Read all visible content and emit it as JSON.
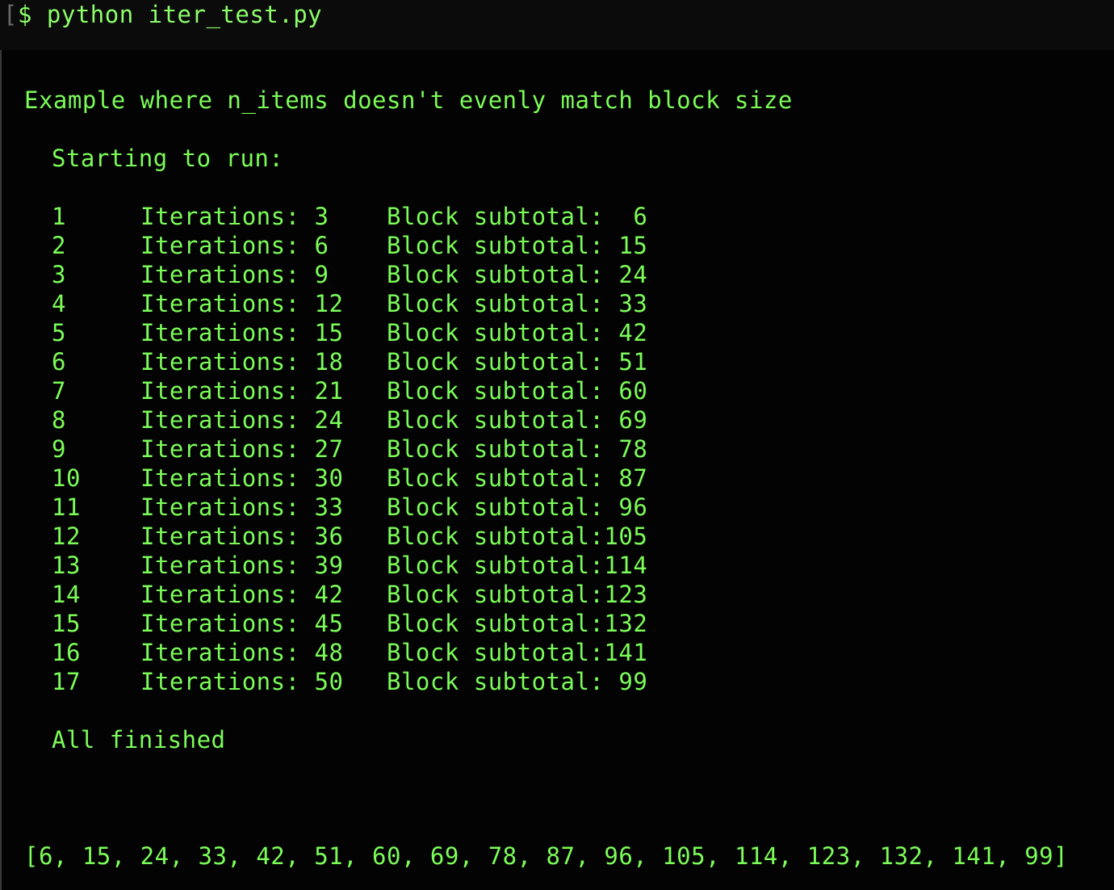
{
  "prompt": {
    "symbol": "$",
    "command": "python iter_test.py"
  },
  "header": "Example where n_items doesn't evenly match block size",
  "starting": "Starting to run:",
  "iter_label": "Iterations:",
  "block_label": "Block subtotal:",
  "rows": [
    {
      "n": "1",
      "iter": "3",
      "block": "  6"
    },
    {
      "n": "2",
      "iter": "6",
      "block": " 15"
    },
    {
      "n": "3",
      "iter": "9",
      "block": " 24"
    },
    {
      "n": "4",
      "iter": "12",
      "block": " 33"
    },
    {
      "n": "5",
      "iter": "15",
      "block": " 42"
    },
    {
      "n": "6",
      "iter": "18",
      "block": " 51"
    },
    {
      "n": "7",
      "iter": "21",
      "block": " 60"
    },
    {
      "n": "8",
      "iter": "24",
      "block": " 69"
    },
    {
      "n": "9",
      "iter": "27",
      "block": " 78"
    },
    {
      "n": "10",
      "iter": "30",
      "block": " 87"
    },
    {
      "n": "11",
      "iter": "33",
      "block": " 96"
    },
    {
      "n": "12",
      "iter": "36",
      "block": "105"
    },
    {
      "n": "13",
      "iter": "39",
      "block": "114"
    },
    {
      "n": "14",
      "iter": "42",
      "block": "123"
    },
    {
      "n": "15",
      "iter": "45",
      "block": "132"
    },
    {
      "n": "16",
      "iter": "48",
      "block": "141"
    },
    {
      "n": "17",
      "iter": "50",
      "block": " 99"
    }
  ],
  "finished": "All finished",
  "result": "[6, 15, 24, 33, 42, 51, 60, 69, 78, 87, 96, 105, 114, 123, 132, 141, 99]",
  "colors": {
    "text": "#7CFC59",
    "background": "#020302"
  }
}
